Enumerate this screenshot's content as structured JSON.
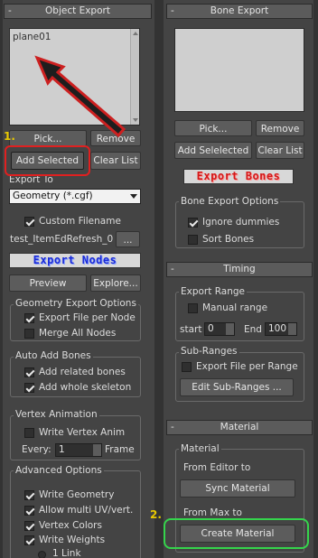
{
  "object_export": {
    "title": "Object Export",
    "collapse": "-",
    "list_item": "plane01",
    "pick_label": "Pick...",
    "remove_label": "Remove",
    "add_selected_label": "Add Selected",
    "clear_list_label": "Clear List",
    "export_to_label": "Export To",
    "export_to_value": "Geometry (*.cgf)",
    "custom_filename_label": "Custom Filename",
    "filename_value": "test_ItemEdRefresh_0",
    "browse_label": "...",
    "export_nodes_label": "Export Nodes",
    "preview_label": "Preview",
    "explore_label": "Explore...",
    "geo_options": {
      "title": "Geometry Export Options",
      "export_file_per_node": "Export File per Node",
      "merge_all_nodes": "Merge All Nodes"
    },
    "auto_add_bones": {
      "title": "Auto Add Bones",
      "add_related_bones": "Add related bones",
      "add_whole_skeleton": "Add whole skeleton"
    },
    "vertex_animation": {
      "title": "Vertex Animation",
      "write_vertex_anim": "Write Vertex Anim",
      "every_label": "Every:",
      "every_value": "1",
      "frame_label": "Frame"
    },
    "advanced": {
      "title": "Advanced Options",
      "write_geometry": "Write Geometry",
      "allow_multi_uv": "Allow multi UV/vert.",
      "vertex_colors": "Vertex Colors",
      "write_weights": "Write Weights",
      "one_link": "1 Link"
    }
  },
  "bone_export": {
    "title": "Bone Export",
    "collapse": "-",
    "pick_label": "Pick...",
    "remove_label": "Remove",
    "add_selected_label": "Add Selelected",
    "clear_list_label": "Clear List",
    "export_bones_label": "Export Bones",
    "options": {
      "title": "Bone Export Options",
      "ignore_dummies": "Ignore dummies",
      "sort_bones": "Sort Bones"
    }
  },
  "timing": {
    "title": "Timing",
    "collapse": "-",
    "export_range_label": "Export Range",
    "manual_range": "Manual range",
    "start_label": "start",
    "start_value": "0",
    "end_label": "End",
    "end_value": "100",
    "sub_ranges_label": "Sub-Ranges",
    "export_file_per_range": "Export File per Range",
    "edit_sub_ranges": "Edit Sub-Ranges ..."
  },
  "material": {
    "title": "Material",
    "collapse": "-",
    "group_label": "Material",
    "from_editor_label": "From Editor to",
    "sync_material": "Sync Material",
    "from_max_label": "From Max to",
    "create_material": "Create Material"
  },
  "annotations": {
    "step1": "1.",
    "step2": "2."
  },
  "colors": {
    "panel_bg": "#444444",
    "annotation_red": "#e02020",
    "annotation_green": "#35d44c",
    "step_number": "#e8c800"
  }
}
